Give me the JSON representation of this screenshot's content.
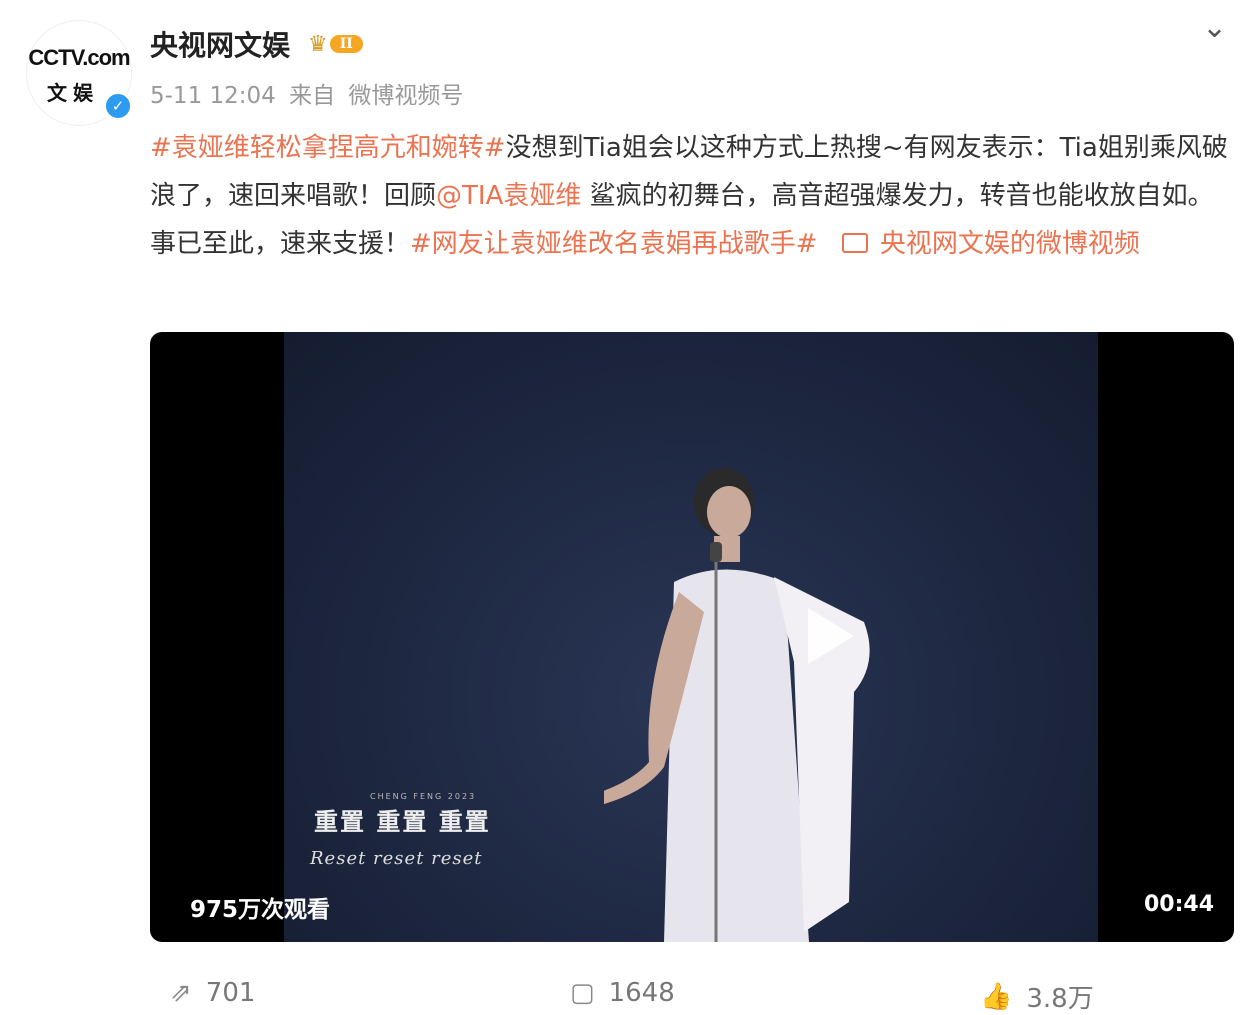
{
  "account": {
    "avatar_logo": "CCTV.com",
    "avatar_sub": "文娱",
    "name": "央视网文娱",
    "vip_level": "II"
  },
  "meta": {
    "time": "5-11 12:04",
    "source_prefix": "来自",
    "source": "微博视频号"
  },
  "post": {
    "tag1": "#袁娅维轻松拿捏高亢和婉转#",
    "text1": "没想到Tia姐会以这种方式上热搜~有网友表示：Tia姐别乘风破浪了，速回来唱歌！回顾",
    "mention": "@TIA袁娅维",
    "text2": " 鲨疯的初舞台，高音超强爆发力，转音也能收放自如。事已至此，速来支援！",
    "tag2": "#网友让袁娅维改名袁娟再战歌手#",
    "video_link_icon": "video-link-icon",
    "video_link": " 央视网文娱的微博视频"
  },
  "video": {
    "caption_cn": "重置 重置 重置",
    "caption_en": "Reset reset reset",
    "caption_small": "CHENG FENG 2023",
    "views": "975万次观看",
    "duration": "00:44"
  },
  "actions": {
    "share_count": "701",
    "comment_count": "1648",
    "like_count": "3.8万"
  },
  "colors": {
    "link": "#eb7350",
    "verified": "#2d9bf0",
    "vip": "#f5a623"
  }
}
